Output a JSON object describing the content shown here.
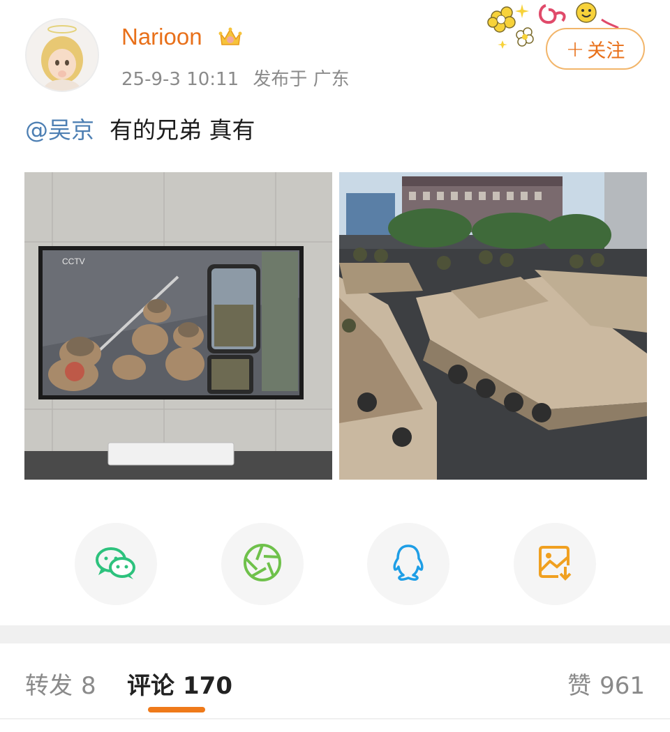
{
  "post": {
    "author": "Narioon",
    "timestamp": "25-9-3 10:11",
    "location": "发布于 广东",
    "follow_label": "关注",
    "mention": "@吴京",
    "text": "有的兄弟 真有"
  },
  "share": [
    {
      "icon": "wechat-icon",
      "color": "#2dc27d"
    },
    {
      "icon": "moments-icon",
      "color": "#6fc14b"
    },
    {
      "icon": "qq-icon",
      "color": "#1e9ee6"
    },
    {
      "icon": "save-image-icon",
      "color": "#f0a020"
    }
  ],
  "tabs": {
    "repost_label": "转发",
    "repost_count": "8",
    "comment_label": "评论",
    "comment_count": "170",
    "like_label": "赞",
    "like_count": "961"
  },
  "colors": {
    "username": "#e8701a",
    "accent": "#ef7a1a",
    "mention": "#4d7fb3"
  }
}
